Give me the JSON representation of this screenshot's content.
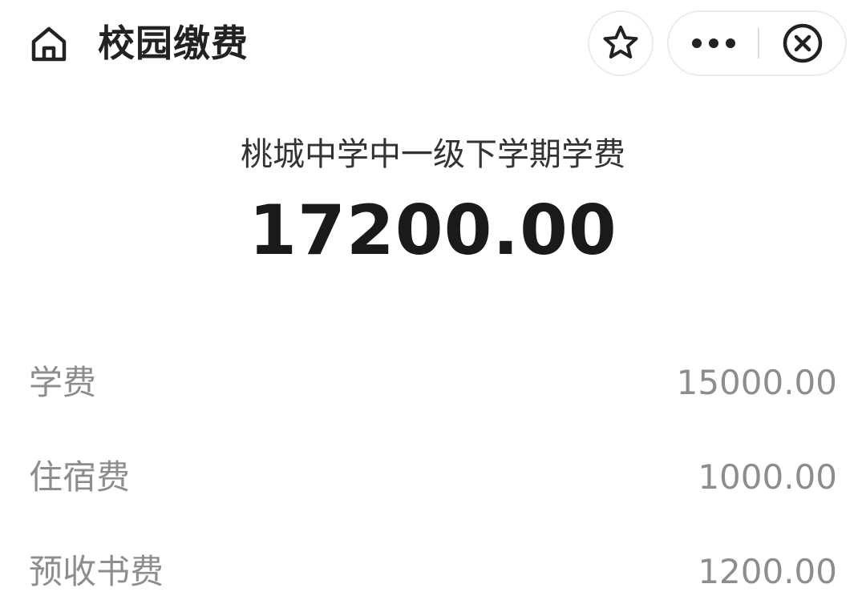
{
  "header": {
    "title": "校园缴费",
    "home_icon": "home-icon",
    "favorite_icon": "star-icon",
    "more_icon": "more-dots-icon",
    "close_icon": "close-circle-icon"
  },
  "summary": {
    "subtitle": "桃城中学中一级下学期学费",
    "total": "17200.00"
  },
  "fees": [
    {
      "label": "学费",
      "amount": "15000.00"
    },
    {
      "label": "住宿费",
      "amount": "1000.00"
    },
    {
      "label": "预收书费",
      "amount": "1200.00"
    }
  ],
  "colors": {
    "title": "#222222",
    "total": "#1a1a1a",
    "fee_text": "#8d8d8d",
    "border": "#ececec"
  }
}
